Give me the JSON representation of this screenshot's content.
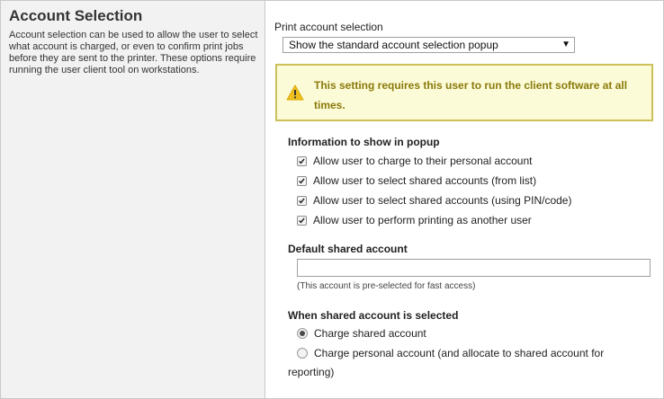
{
  "left": {
    "title": "Account Selection",
    "description": "Account selection can be used to allow the user to select what account is charged, or even to confirm print jobs before they are sent to the printer. These options require running the user client tool on workstations."
  },
  "print_selection": {
    "label": "Print account selection",
    "selected": "Show the standard account selection popup"
  },
  "warning": {
    "icon": "warning-triangle-icon",
    "text": "This setting requires this user to run the client software at all times.",
    "colors": {
      "background": "#fcfbd7",
      "border": "#cbc05a",
      "text": "#8a7a0a",
      "icon": "#f0c020"
    }
  },
  "popup_info": {
    "label": "Information to show in popup",
    "options": [
      {
        "label": "Allow user to charge to their personal account",
        "checked": true
      },
      {
        "label": "Allow user to select shared accounts (from list)",
        "checked": true
      },
      {
        "label": "Allow user to select shared accounts (using PIN/code)",
        "checked": true
      },
      {
        "label": "Allow user to perform printing as another user",
        "checked": true
      }
    ]
  },
  "default_shared": {
    "label": "Default shared account",
    "value": "",
    "hint": "(This account is pre-selected for fast access)"
  },
  "when_shared": {
    "label": "When shared account is selected",
    "options": [
      {
        "label": "Charge shared account",
        "checked": true
      },
      {
        "label": "Charge personal account (and allocate to shared account for",
        "continuation": "reporting)",
        "checked": false
      }
    ]
  }
}
